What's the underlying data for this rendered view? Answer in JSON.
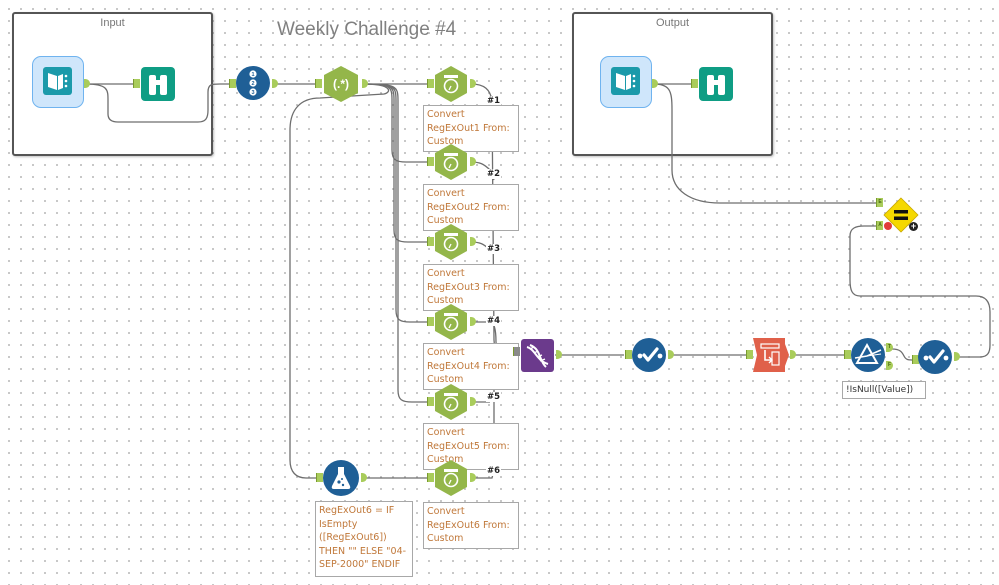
{
  "canvas": {
    "title": "Weekly Challenge #4"
  },
  "containers": [
    {
      "id": "input",
      "title": "Input"
    },
    {
      "id": "output",
      "title": "Output"
    }
  ],
  "tools": {
    "input_data": {
      "type": "Input Data",
      "icon": "book-icon",
      "color": "#1b9aaa"
    },
    "browse_input": {
      "type": "Browse",
      "icon": "binoculars-icon",
      "color": "#0f9d84"
    },
    "record_id": {
      "type": "Record ID",
      "icon": "numbered-list-icon",
      "color": "#1f5f96"
    },
    "regex": {
      "type": "RegEx",
      "icon": "regex-icon",
      "glyph": "(.*)",
      "color": "#94b64a"
    },
    "datetime_tools": [
      {
        "num": "#1",
        "annotation": "Convert RegExOut1 From: Custom"
      },
      {
        "num": "#2",
        "annotation": "Convert RegExOut2 From: Custom"
      },
      {
        "num": "#3",
        "annotation": "Convert RegExOut3 From: Custom"
      },
      {
        "num": "#4",
        "annotation": "Convert RegExOut4 From: Custom"
      },
      {
        "num": "#5",
        "annotation": "Convert RegExOut5 From: Custom"
      },
      {
        "num": "#6",
        "annotation": "Convert RegExOut6 From: Custom"
      }
    ],
    "formula": {
      "type": "Formula",
      "icon": "flask-icon",
      "annotation": "RegExOut6 = IF IsEmpty ([RegExOut6]) THEN \"\" ELSE \"04-SEP-2000\" ENDIF"
    },
    "join_multiple": {
      "type": "Join Multiple",
      "icon": "dna-icon",
      "color": "#6b3a8c"
    },
    "select_1": {
      "type": "Select",
      "icon": "checkmark-icon",
      "color": "#1f5f96"
    },
    "transpose": {
      "type": "Transpose",
      "icon": "transpose-icon",
      "color": "#e0604a"
    },
    "filter": {
      "type": "Filter",
      "icon": "prism-icon",
      "annotation": "!IsNull([Value])",
      "true_label": "T",
      "false_label": "F"
    },
    "select_2": {
      "type": "Select",
      "icon": "checkmark-icon",
      "color": "#1f5f96"
    },
    "test": {
      "type": "Expect Equal",
      "icon": "equals-icon",
      "color": "#f5d800",
      "expected_label": "E",
      "actual_label": "A"
    },
    "output_data": {
      "type": "Input Data",
      "icon": "book-icon"
    },
    "browse_output": {
      "type": "Browse",
      "icon": "binoculars-icon"
    }
  }
}
